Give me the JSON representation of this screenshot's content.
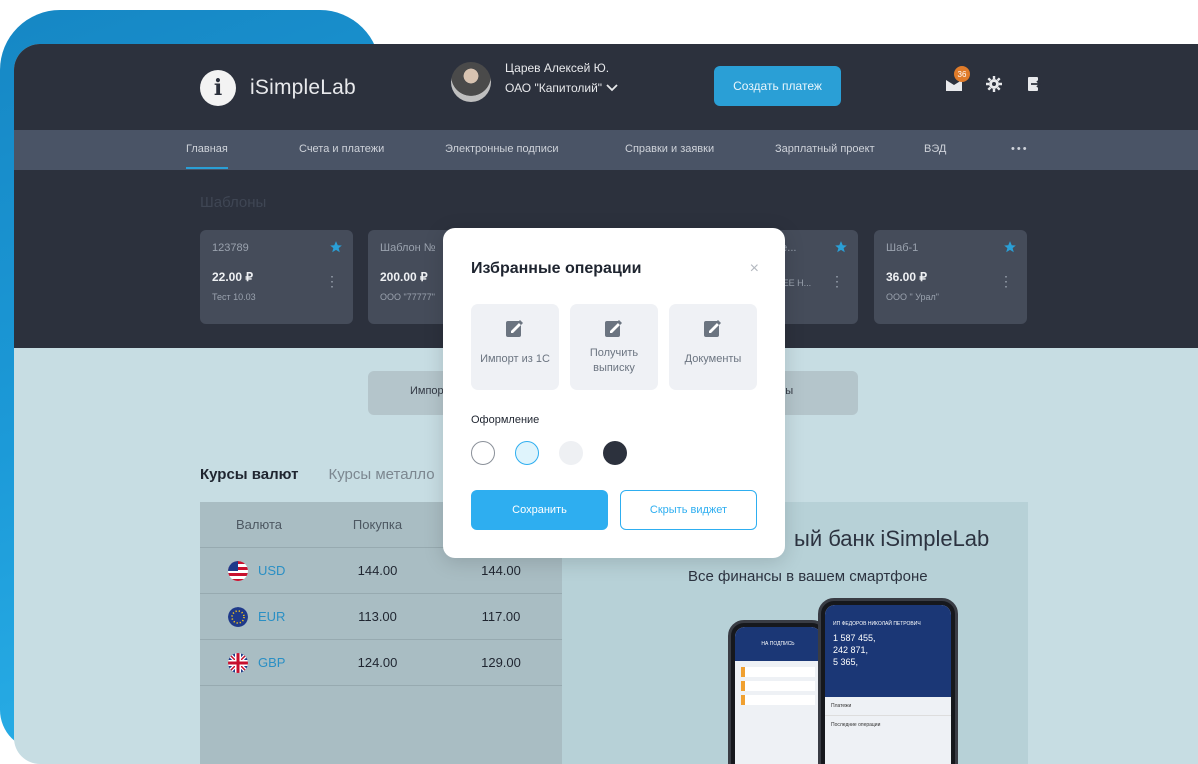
{
  "header": {
    "logo_letter": "i",
    "app_name": "iSimpleLab",
    "user_name": "Царев Алексей Ю.",
    "company": "ОАО \"Капитолий\"",
    "create_payment": "Создать платеж",
    "notifications_count": "36"
  },
  "nav": {
    "items": [
      "Главная",
      "Счета и платежи",
      "Электронные подписи",
      "Справки и заявки",
      "Зарплатный проект",
      "ВЭД"
    ],
    "more": "•••"
  },
  "templates": {
    "title": "Шаблоны",
    "cards": [
      {
        "name": "123789",
        "amount": "22.00 ₽",
        "desc": "Тест 10.03"
      },
      {
        "name": "Шаблон №",
        "amount": "200.00 ₽",
        "desc": "ООО \"77777\""
      },
      {
        "name": "плате...",
        "amount": "",
        "desc": "АБОЧЕЕ Н..."
      },
      {
        "name": "Шаб-1",
        "amount": "36.00 ₽",
        "desc": "ООО \" Урал\""
      }
    ]
  },
  "operations_strip": {
    "left": "Импор",
    "right": "енты"
  },
  "rates": {
    "tab_active": "Курсы валют",
    "tab_other": "Курсы металло",
    "headers": [
      "Валюта",
      "Покупка"
    ],
    "rows": [
      {
        "currency": "USD",
        "buy": "144.00",
        "sell": "144.00"
      },
      {
        "currency": "EUR",
        "buy": "113.00",
        "sell": "117.00"
      },
      {
        "currency": "GBP",
        "buy": "124.00",
        "sell": "129.00"
      }
    ]
  },
  "promo": {
    "title": "ый банк iSimpleLab",
    "subtitle": "Все финансы в вашем смартфоне",
    "phone_back_header": "НА ПОДПИСЬ",
    "phone_front_name": "ИП ФЕДОРОВ НИКОЛАЙ ПЕТРОВИЧ",
    "phone_front_balances": [
      "1 587 455,",
      "242 871,",
      "5 365,"
    ],
    "phone_front_section": "Платежи",
    "phone_front_last": "Последние операции"
  },
  "modal": {
    "title": "Избранные операции",
    "close": "×",
    "tiles": [
      {
        "label": "Импорт из 1С"
      },
      {
        "label": "Получить выписку"
      },
      {
        "label": "Документы"
      }
    ],
    "design_label": "Оформление",
    "swatches": [
      "#ffffff",
      "#dff4fc",
      "#eef0f3",
      "#2c313d"
    ],
    "save": "Сохранить",
    "hide": "Скрыть виджет"
  },
  "colors": {
    "accent": "#2eaef0",
    "dark": "#2c313d"
  }
}
